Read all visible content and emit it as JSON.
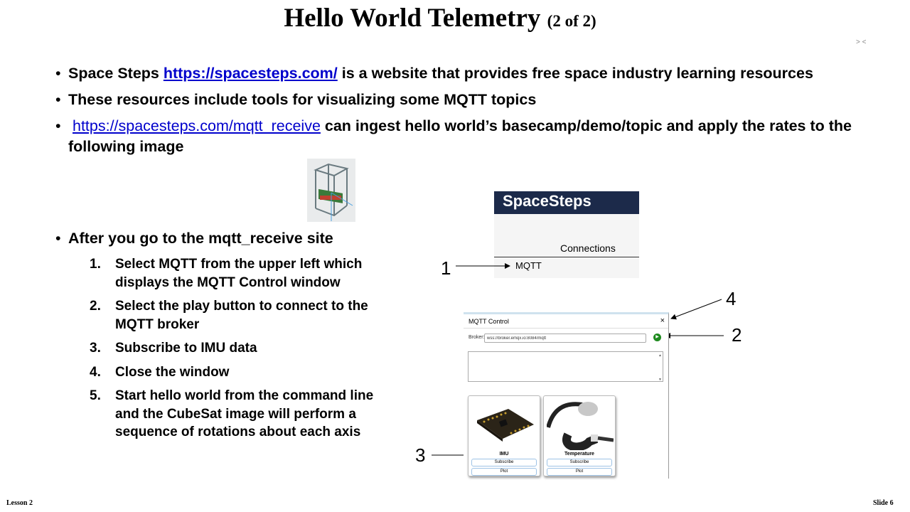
{
  "slide": {
    "title": "Hello World Telemetry",
    "title_sub": "(2 of 2)",
    "corner_mark": "> <",
    "bullets": [
      {
        "prefix": "Space Steps ",
        "link": "https://spacesteps.com/",
        "suffix": " is a website that provides free space industry learning resources"
      },
      {
        "text": "These resources include tools for visualizing some MQTT topics"
      },
      {
        "link": "https://spacesteps.com/mqtt_receive",
        "suffix": " can ingest hello world’s basecamp/demo/topic and apply the rates to the following image"
      }
    ],
    "bullet_after": "After you go to the mqtt_receive site",
    "steps": [
      {
        "num": "1.",
        "text": "Select MQTT from the upper left which displays the MQTT Control window"
      },
      {
        "num": "2.",
        "text": "Select the play button to connect to the MQTT broker"
      },
      {
        "num": "3.",
        "text": "Subscribe to IMU data"
      },
      {
        "num": "4.",
        "text": "Close the window"
      },
      {
        "num": "5.",
        "text": "Start hello world from the command line and the CubeSat image will perform a sequence of rotations about each axis"
      }
    ],
    "footer_left": "Lesson 2",
    "footer_right": "Slide 6"
  },
  "spacesteps": {
    "header": "SpaceSteps",
    "connections_label": "Connections",
    "mqtt_item": "MQTT"
  },
  "callouts": {
    "c1": "1",
    "c2": "2",
    "c3": "3",
    "c4": "4"
  },
  "mqtt_control": {
    "title": "MQTT Control",
    "close_glyph": "×",
    "broker_label": "Broker:",
    "broker_value": "wss://broker.emqx.io:8084/mqtt",
    "play_glyph": "▶",
    "scroll_glyph_up": "▲",
    "scroll_glyph_down": "▼",
    "cards": [
      {
        "name": "IMU",
        "subscribe": "Subscribe",
        "plot": "Plot"
      },
      {
        "name": "Temperature",
        "subscribe": "Subscribe",
        "plot": "Plot"
      }
    ]
  },
  "colors": {
    "link": "#0000cc",
    "header_bg": "#1c2a4a",
    "play_green": "#1f8a1f"
  }
}
